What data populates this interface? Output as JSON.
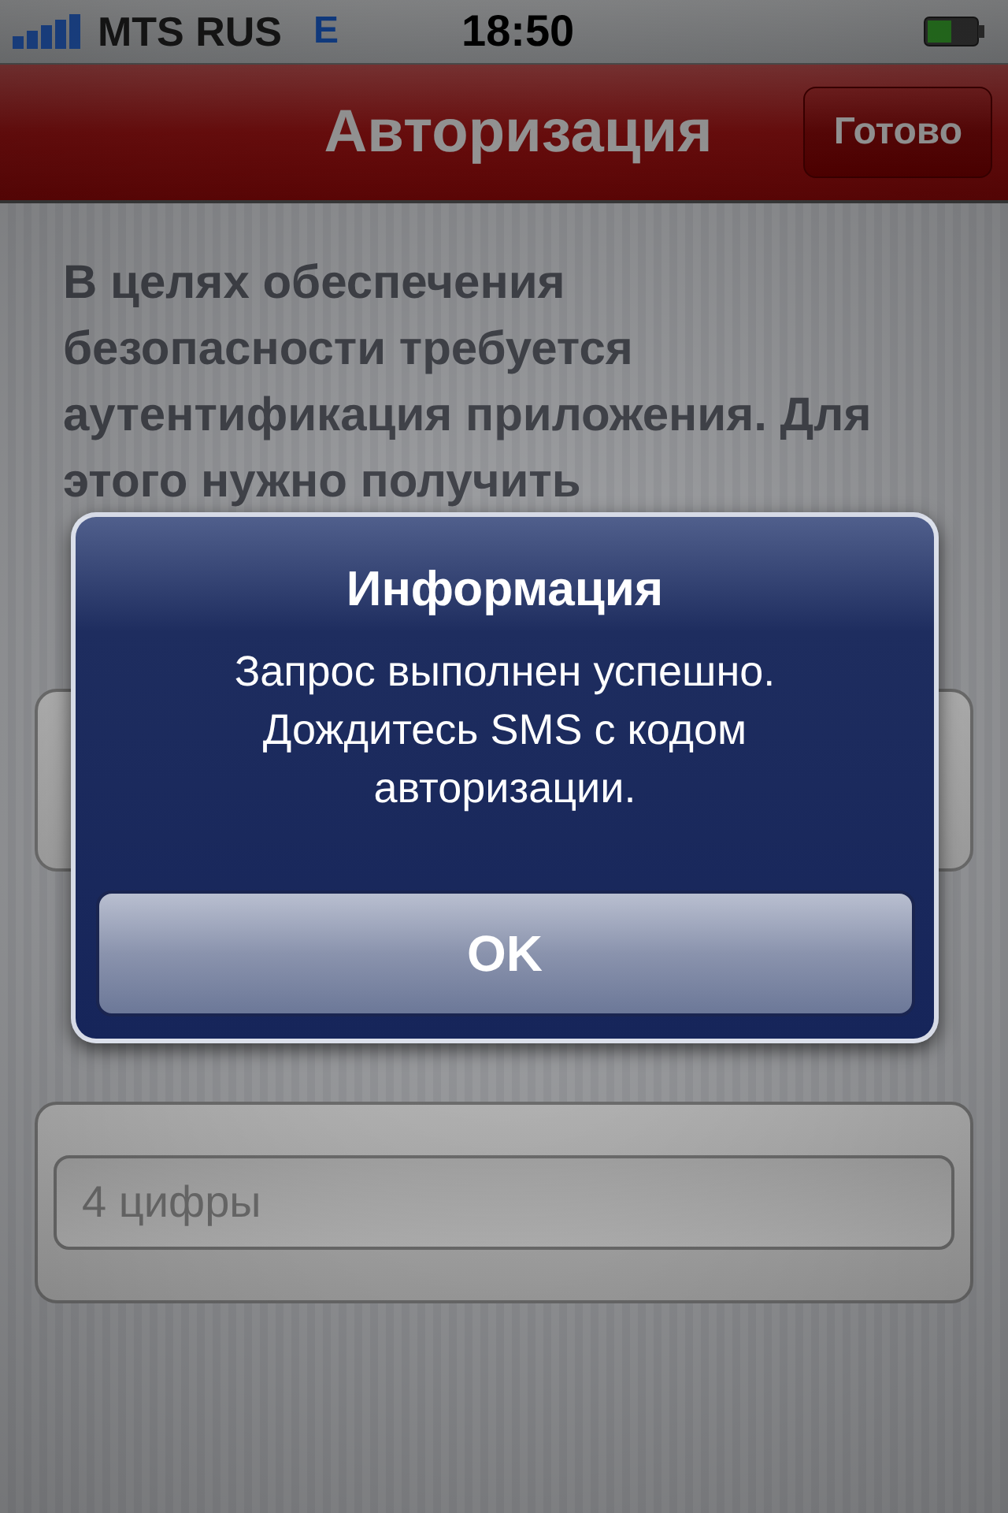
{
  "status_bar": {
    "carrier": "MTS RUS",
    "network": "E",
    "time": "18:50"
  },
  "nav_bar": {
    "title": "Авторизация",
    "done_button": "Готово"
  },
  "intro": "В целях обеспечения безопасности требуется аутентификация приложения. Для этого нужно получить",
  "code_field": {
    "placeholder": "4 цифры"
  },
  "alert": {
    "title": "Информация",
    "message": "Запрос выполнен успешно. Дождитесь SMS с кодом авторизации.",
    "buttons": [
      "OK"
    ]
  }
}
